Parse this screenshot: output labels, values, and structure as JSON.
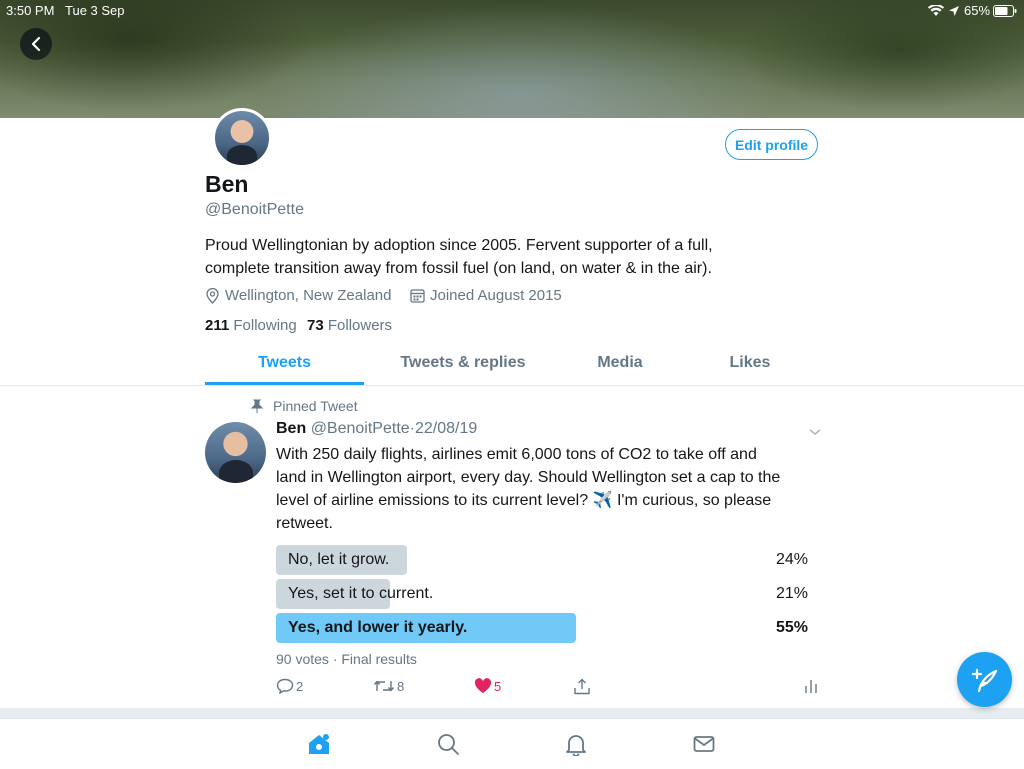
{
  "status_bar": {
    "time": "3:50 PM",
    "date": "Tue 3 Sep",
    "battery": "65%"
  },
  "profile": {
    "name": "Ben",
    "handle": "@BenoitPette",
    "bio_line1": "Proud Wellingtonian by adoption since 2005. Fervent supporter of a full,",
    "bio_line2": "complete transition away from fossil fuel (on land, on water & in the air).",
    "location": "Wellington, New Zealand",
    "joined": "Joined August 2015",
    "following_count": "211",
    "following_label": "Following",
    "followers_count": "73",
    "followers_label": "Followers",
    "edit_label": "Edit profile"
  },
  "tabs": [
    {
      "label": "Tweets",
      "active": true
    },
    {
      "label": "Tweets & replies"
    },
    {
      "label": "Media"
    },
    {
      "label": "Likes"
    }
  ],
  "tweet": {
    "pinned_label": "Pinned Tweet",
    "name": "Ben",
    "handle": "@BenoitPette",
    "sep": "·",
    "date": "22/08/19",
    "text_line1": "With 250 daily flights, airlines emit 6,000 tons of CO2 to take off and",
    "text_line2": "land in Wellington airport, every day. Should Wellington set a cap to the",
    "text_line3a": "level of airline emissions to its current level?",
    "text_emoji": "✈️",
    "text_line3b": "I'm curious, so please",
    "text_line4": "retweet.",
    "poll": [
      {
        "label": "No, let it grow.",
        "percent": "24%",
        "value": 24
      },
      {
        "label": "Yes, set it to current.",
        "percent": "21%",
        "value": 21
      },
      {
        "label": "Yes, and lower it yearly.",
        "percent": "55%",
        "value": 55,
        "winner": true
      }
    ],
    "votes": "90 votes · Final results",
    "replies": "2",
    "retweets": "8",
    "likes": "5"
  },
  "colors": {
    "accent": "#1da1f2",
    "like": "#e0245e",
    "poll_bar": "#ccd6dd",
    "poll_winner": "#71c9f8"
  },
  "icons": [
    "back-icon",
    "wifi-icon",
    "location-arrow-icon",
    "battery-icon",
    "location-pin-icon",
    "calendar-icon",
    "pin-icon",
    "chevron-down-icon",
    "reply-icon",
    "retweet-icon",
    "heart-icon",
    "share-icon",
    "analytics-icon",
    "compose-icon",
    "home-icon",
    "search-icon",
    "notifications-icon",
    "messages-icon"
  ]
}
